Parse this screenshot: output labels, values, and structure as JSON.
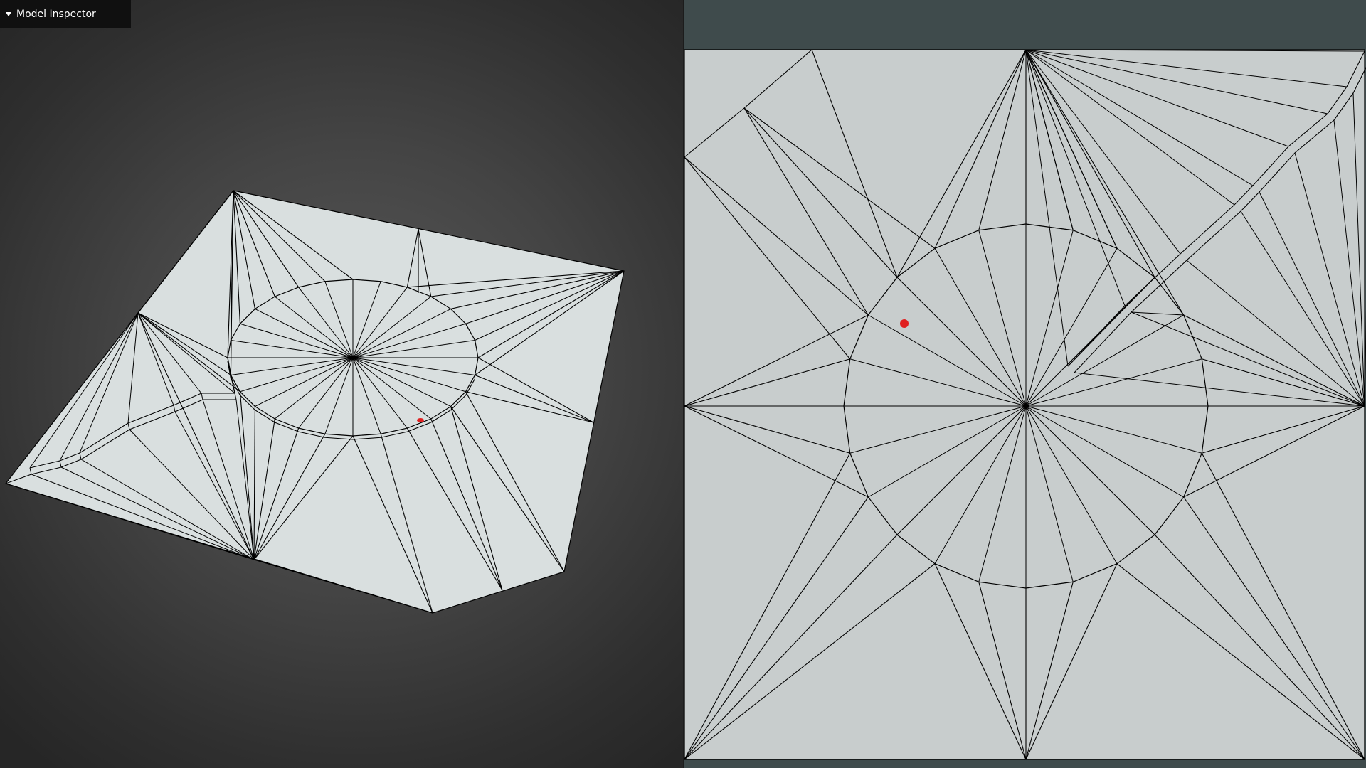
{
  "inspector": {
    "title": "Model Inspector",
    "expanded": true,
    "chevron_icon": "chevron-down-icon"
  },
  "viewport_3d": {
    "background": "#2f2f2f",
    "mesh_fill": "#d9dfdf",
    "edge_color": "#000000"
  },
  "viewport_uv": {
    "background": "#3f4b4c",
    "uv_fill": "#c8cdcd",
    "edge_color": "#000000"
  },
  "marker": {
    "color": "#e02020",
    "icon": "red-dot-marker"
  }
}
